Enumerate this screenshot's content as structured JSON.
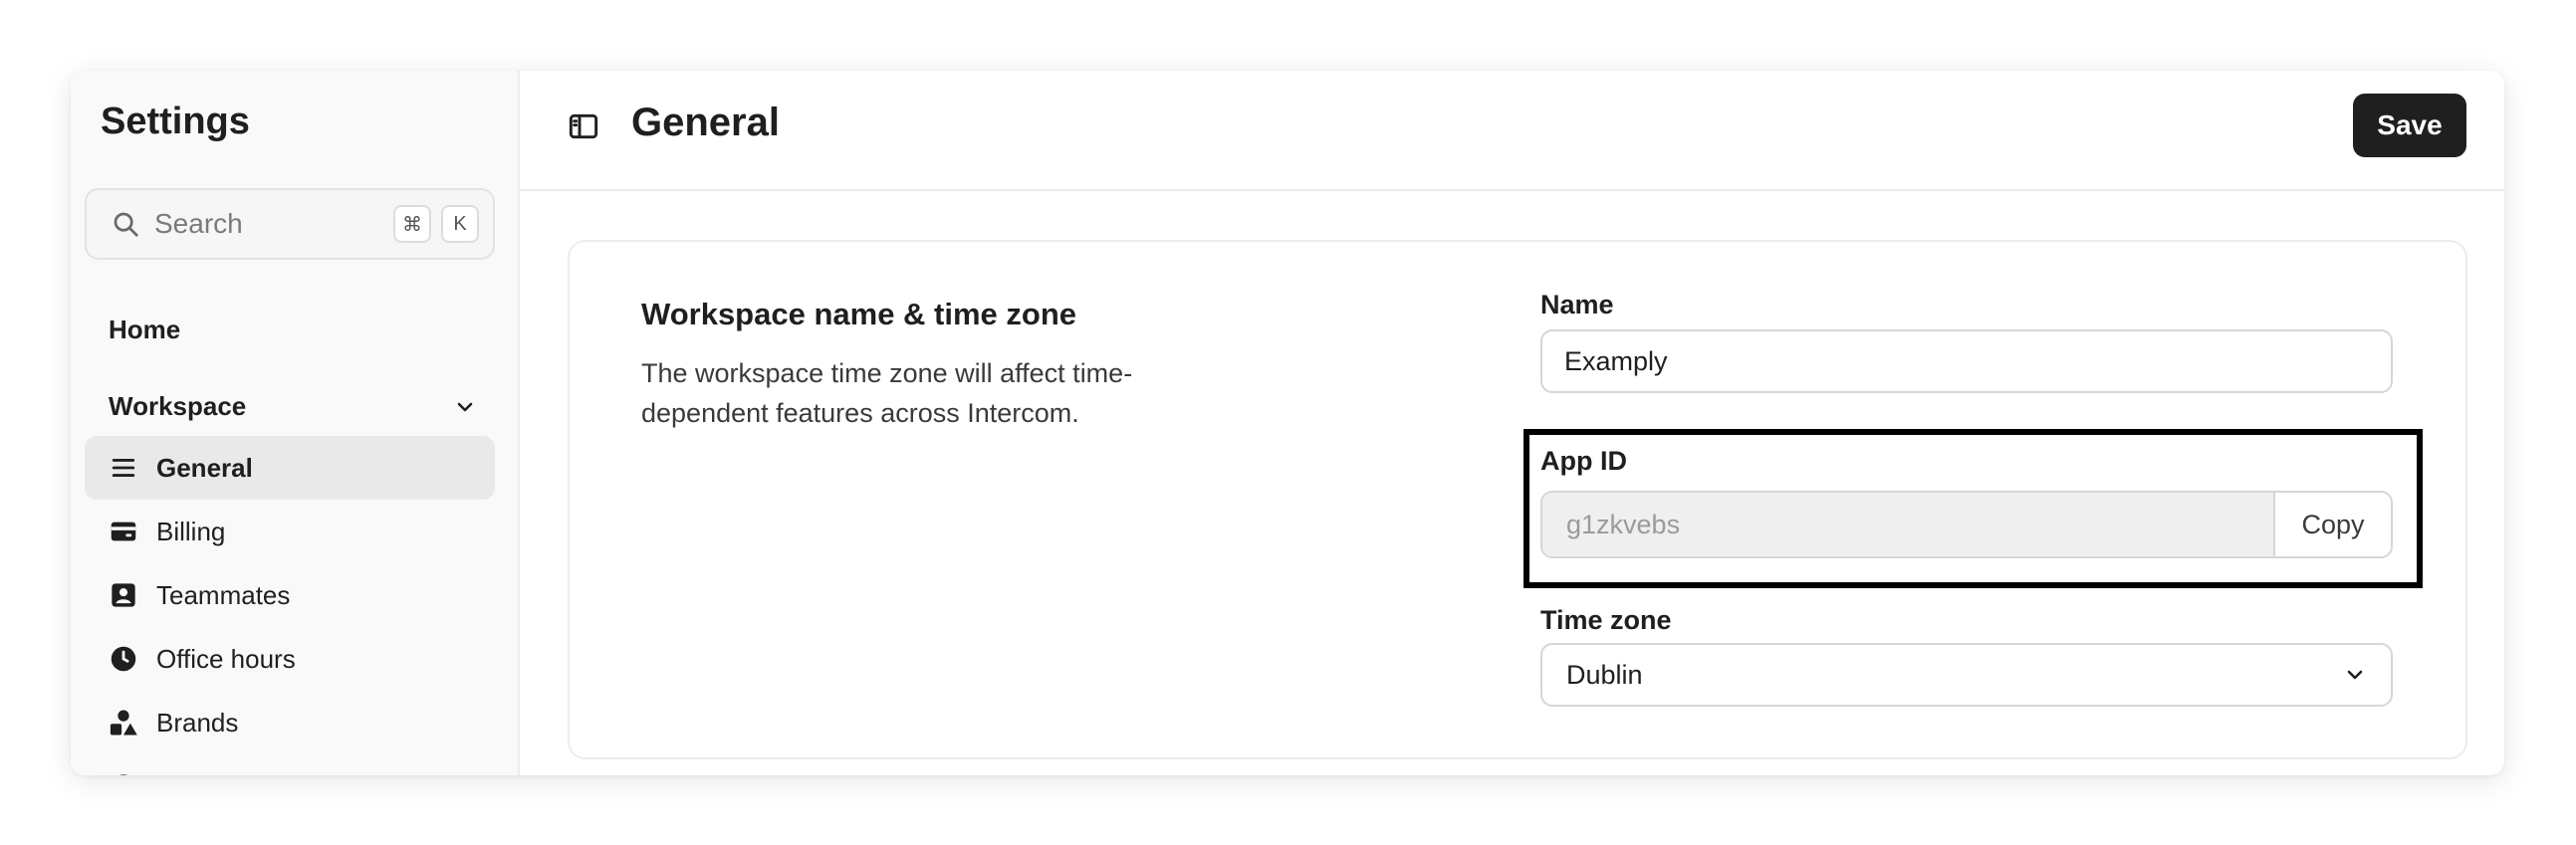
{
  "sidebar": {
    "title": "Settings",
    "search": {
      "placeholder": "Search",
      "shortcut_mod": "⌘",
      "shortcut_key": "K"
    },
    "home_label": "Home",
    "workspace_label": "Workspace",
    "items": [
      {
        "label": "General",
        "icon": "list-icon",
        "active": true
      },
      {
        "label": "Billing",
        "icon": "credit-card-icon",
        "active": false
      },
      {
        "label": "Teammates",
        "icon": "contact-card-icon",
        "active": false
      },
      {
        "label": "Office hours",
        "icon": "clock-icon",
        "active": false
      },
      {
        "label": "Brands",
        "icon": "shapes-icon",
        "active": false
      }
    ]
  },
  "header": {
    "title": "General",
    "save_label": "Save"
  },
  "section": {
    "title": "Workspace name & time zone",
    "description": "The workspace time zone will affect time-dependent features across Intercom."
  },
  "form": {
    "name_label": "Name",
    "name_value": "Examply",
    "app_id_label": "App ID",
    "app_id_value": "g1zkvebs",
    "copy_label": "Copy",
    "timezone_label": "Time zone",
    "timezone_value": "Dublin"
  },
  "colors": {
    "accent": "#1f1f1f",
    "sidebar_bg": "#f9f9f9",
    "active_bg": "#e9e9e9",
    "highlight_border": "#000000"
  }
}
